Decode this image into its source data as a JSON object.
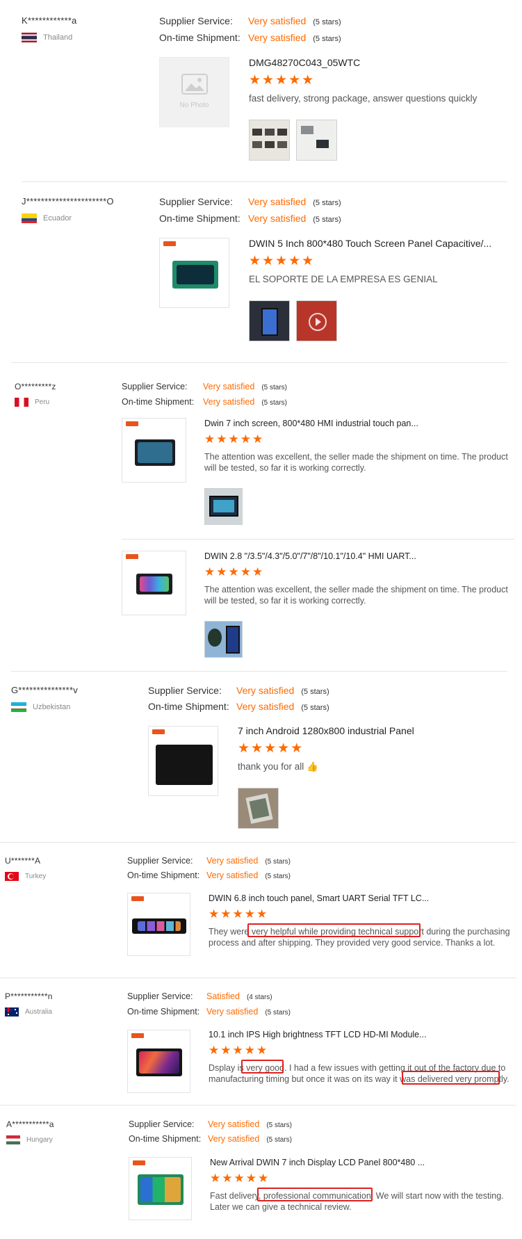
{
  "labels": {
    "supplier_service": "Supplier Service:",
    "ontime_shipment": "On-time Shipment:"
  },
  "no_photo": "No Photo",
  "star_glyphs": "★★★★★",
  "reviews": [
    {
      "buyer": "K************a",
      "country": "Thailand",
      "supplier_value": "Very satisfied",
      "supplier_stars": "(5 stars)",
      "shipment_value": "Very satisfied",
      "shipment_stars": "(5 stars)",
      "products": [
        {
          "title": "DMG48270C043_05WTC",
          "comment": "fast delivery, strong package, answer questions quickly"
        }
      ]
    },
    {
      "buyer": "J**********************O",
      "country": "Ecuador",
      "supplier_value": "Very satisfied",
      "supplier_stars": "(5 stars)",
      "shipment_value": "Very satisfied",
      "shipment_stars": "(5 stars)",
      "products": [
        {
          "title": "DWIN 5 Inch 800*480 Touch Screen Panel Capacitive/...",
          "comment": "EL SOPORTE DE LA EMPRESA ES GENIAL"
        }
      ]
    },
    {
      "buyer": "O*********z",
      "country": "Peru",
      "supplier_value": "Very satisfied",
      "supplier_stars": "(5 stars)",
      "shipment_value": "Very satisfied",
      "shipment_stars": "(5 stars)",
      "products": [
        {
          "title": "Dwin 7 inch screen, 800*480 HMI industrial touch pan...",
          "comment": "The attention was excellent, the seller made the shipment on time.  The product will be tested, so far it is working correctly."
        },
        {
          "title": "DWIN 2.8 \"/3.5\"/4.3\"/5.0\"/7\"/8\"/10.1\"/10.4\" HMI UART...",
          "comment": "The attention was excellent, the seller made the shipment on time.  The product will be tested, so far it is working correctly."
        }
      ]
    },
    {
      "buyer": "G***************v",
      "country": "Uzbekistan",
      "supplier_value": "Very satisfied",
      "supplier_stars": "(5 stars)",
      "shipment_value": "Very satisfied",
      "shipment_stars": "(5 stars)",
      "products": [
        {
          "title": "7 inch Android 1280x800 industrial Panel",
          "comment": "thank you for all 👍"
        }
      ]
    },
    {
      "buyer": "U*******A",
      "country": "Turkey",
      "supplier_value": "Very satisfied",
      "supplier_stars": "(5 stars)",
      "shipment_value": "Very satisfied",
      "shipment_stars": "(5 stars)",
      "products": [
        {
          "title": "DWIN 6.8 inch touch panel, Smart UART Serial TFT LC...",
          "comment": "They were very helpful while providing technical support during the purchasing process and after shipping. They provided very good service. Thanks a lot."
        }
      ]
    },
    {
      "buyer": "P***********n",
      "country": "Australia",
      "supplier_value": "Satisfied",
      "supplier_stars": "(4 stars)",
      "shipment_value": "Very satisfied",
      "shipment_stars": "(5 stars)",
      "products": [
        {
          "title": "10.1 inch IPS High brightness TFT LCD HD-MI Module...",
          "comment": "Dsplay is very good. I had a few issues with getting it out of the factory due to manufacturing timing but once it was on its way it was delivered very promptly."
        }
      ]
    },
    {
      "buyer": "A***********a",
      "country": "Hungary",
      "supplier_value": "Very satisfied",
      "supplier_stars": "(5 stars)",
      "shipment_value": "Very satisfied",
      "shipment_stars": "(5 stars)",
      "products": [
        {
          "title": "New Arrival DWIN 7 inch Display LCD Panel 800*480 ...",
          "comment": "Fast delivery, professional communication. We will start now with the testing. Later we can give a technical review."
        }
      ]
    }
  ]
}
